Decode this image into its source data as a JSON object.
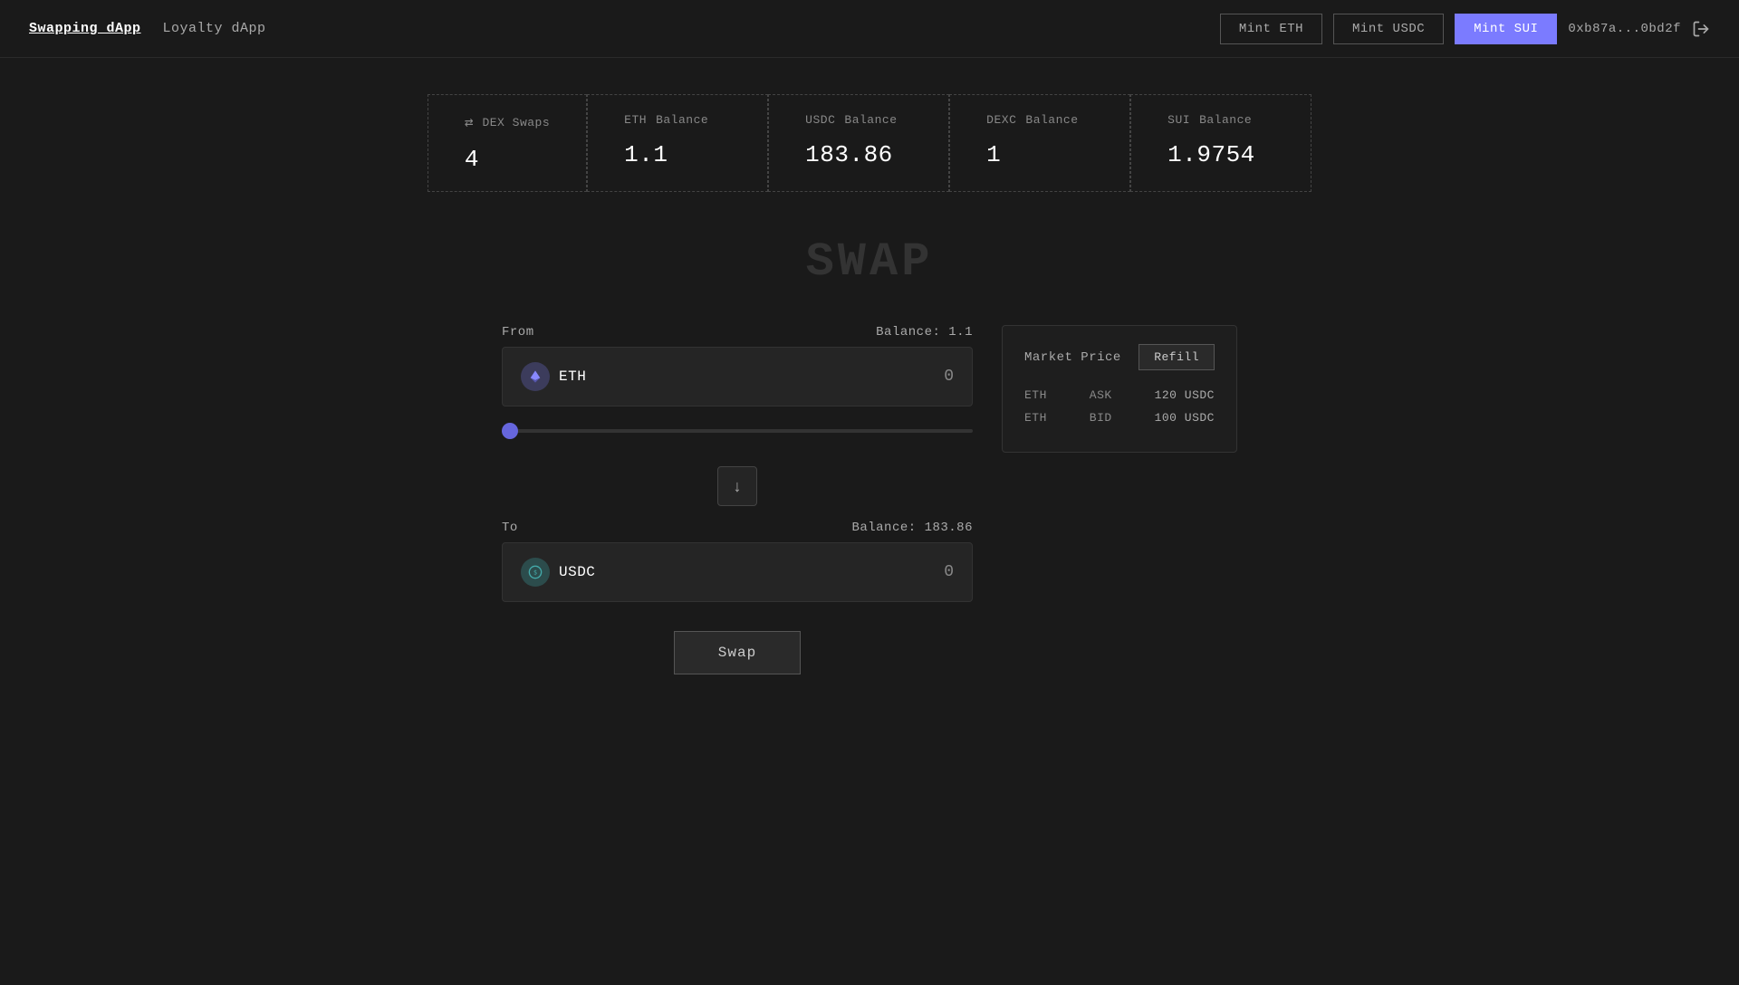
{
  "header": {
    "nav": [
      {
        "id": "swapping",
        "label": "Swapping dApp",
        "active": true
      },
      {
        "id": "loyalty",
        "label": "Loyalty dApp",
        "active": false
      }
    ],
    "actions": {
      "mint_eth_label": "Mint ETH",
      "mint_usdc_label": "Mint USDC",
      "mint_sui_label": "Mint SUI",
      "wallet_address": "0xb87a...0bd2f",
      "logout_icon": "→"
    }
  },
  "stats": [
    {
      "id": "dex-swaps",
      "icon": "⇄",
      "label": "DEX Swaps",
      "value": "4"
    },
    {
      "id": "eth-balance",
      "icon": null,
      "label": "Balance",
      "token": "ETH",
      "value": "1.1"
    },
    {
      "id": "usdc-balance",
      "icon": null,
      "label": "Balance",
      "token": "USDC",
      "value": "183.86"
    },
    {
      "id": "dexc-balance",
      "icon": null,
      "label": "Balance",
      "token": "DEXC",
      "value": "1"
    },
    {
      "id": "sui-balance",
      "icon": null,
      "label": "Balance",
      "token": "SUI",
      "value": "1.9754"
    }
  ],
  "swap": {
    "title": "SWAP",
    "from": {
      "label": "From",
      "balance_label": "Balance:",
      "balance_value": "1.1",
      "token": "ETH",
      "amount": "0"
    },
    "to": {
      "label": "To",
      "balance_label": "Balance:",
      "balance_value": "183.86",
      "token": "USDC",
      "amount": "0"
    },
    "swap_button_label": "Swap",
    "direction_icon": "↓",
    "slider_value": 0
  },
  "market_price": {
    "title": "Market Price",
    "refill_label": "Refill",
    "rows": [
      {
        "token": "ETH",
        "type": "ASK",
        "price": "120 USDC"
      },
      {
        "token": "ETH",
        "type": "BID",
        "price": "100 USDC"
      }
    ]
  }
}
